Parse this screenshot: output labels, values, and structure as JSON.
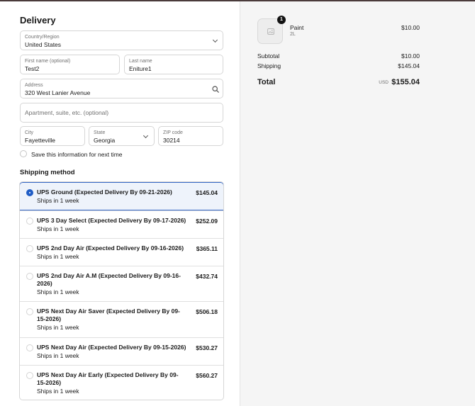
{
  "delivery": {
    "heading": "Delivery",
    "country": {
      "label": "Country/Region",
      "value": "United States"
    },
    "first_name": {
      "label": "First name (optional)",
      "value": "Test2"
    },
    "last_name": {
      "label": "Last name",
      "value": "Eniture1"
    },
    "address": {
      "label": "Address",
      "value": "320 West Lanier Avenue"
    },
    "apartment": {
      "placeholder": "Apartment, suite, etc. (optional)"
    },
    "city": {
      "label": "City",
      "value": "Fayetteville"
    },
    "state": {
      "label": "State",
      "value": "Georgia"
    },
    "zip": {
      "label": "ZIP code",
      "value": "30214"
    },
    "save_info": "Save this information for next time"
  },
  "shipping": {
    "heading": "Shipping method",
    "options": [
      {
        "title": "UPS Ground (Expected Delivery By 09-21-2026)",
        "sub": "Ships in 1 week",
        "price": "$145.04",
        "selected": true
      },
      {
        "title": "UPS 3 Day Select (Expected Delivery By 09-17-2026)",
        "sub": "Ships in 1 week",
        "price": "$252.09",
        "selected": false
      },
      {
        "title": "UPS 2nd Day Air (Expected Delivery By 09-16-2026)",
        "sub": "Ships in 1 week",
        "price": "$365.11",
        "selected": false
      },
      {
        "title": "UPS 2nd Day Air A.M (Expected Delivery By 09-16-2026)",
        "sub": "Ships in 1 week",
        "price": "$432.74",
        "selected": false
      },
      {
        "title": "UPS Next Day Air Saver (Expected Delivery By 09-15-2026)",
        "sub": "Ships in 1 week",
        "price": "$506.18",
        "selected": false
      },
      {
        "title": "UPS Next Day Air (Expected Delivery By 09-15-2026)",
        "sub": "Ships in 1 week",
        "price": "$530.27",
        "selected": false
      },
      {
        "title": "UPS Next Day Air Early (Expected Delivery By 09-15-2026)",
        "sub": "Ships in 1 week",
        "price": "$560.27",
        "selected": false
      }
    ]
  },
  "summary": {
    "product": {
      "name": "Paint",
      "variant": "2L",
      "price": "$10.00",
      "quantity": "1",
      "icon": "image-placeholder-icon"
    },
    "subtotal_label": "Subtotal",
    "subtotal": "$10.00",
    "shipping_label": "Shipping",
    "shipping": "$145.04",
    "total_label": "Total",
    "currency": "USD",
    "total": "$155.04"
  },
  "colors": {
    "accent": "#1f5cc5",
    "selected_bg": "#eef3fb",
    "summary_bg": "#f5f5f5"
  }
}
